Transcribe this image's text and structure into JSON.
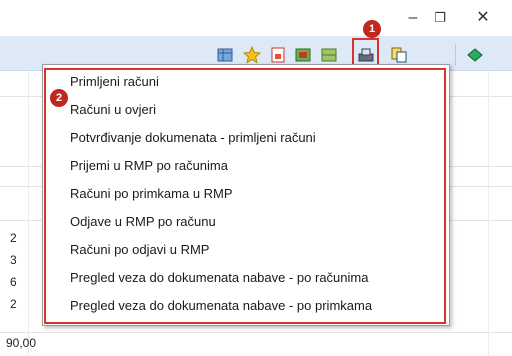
{
  "window": {
    "minimize": "–",
    "restore": "❐",
    "close": "✕"
  },
  "toolbar": {
    "icons": [
      "grid-icon",
      "star-icon",
      "document-icon",
      "image-icon",
      "print-scan-icon",
      "copy-icon",
      "book-icon"
    ]
  },
  "badges": {
    "toolbar_badge": "1",
    "menu_badge": "2"
  },
  "menu": {
    "items": [
      "Primljeni računi",
      "Računi u ovjeri",
      "Potvrđivanje dokumenata - primljeni računi",
      "Prijemi u RMP po računima",
      "Računi po primkama u RMP",
      "Odjave u RMP po računu",
      "Računi po odjavi u RMP",
      "Pregled veza do dokumenata nabave - po računima",
      "Pregled veza do dokumenata nabave - po primkama"
    ]
  },
  "grid": {
    "row_numbers": [
      "2",
      "3",
      "6",
      "2"
    ],
    "bottom_value": "90,00"
  },
  "colors": {
    "highlight": "#d9342b",
    "badge": "#c0281f",
    "toolbar_bg": "#dde9f7"
  }
}
